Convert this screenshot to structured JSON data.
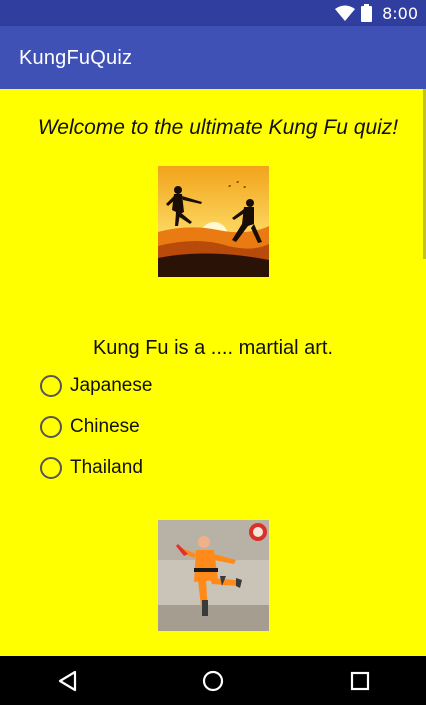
{
  "status_bar": {
    "time": "8:00",
    "icons": [
      "wifi-icon",
      "battery-icon"
    ]
  },
  "app_bar": {
    "title": "KungFuQuiz"
  },
  "main": {
    "welcome_text": "Welcome to the ultimate Kung Fu quiz!",
    "question": "Kung Fu is a .... martial art.",
    "options": [
      {
        "label": "Japanese",
        "selected": false
      },
      {
        "label": "Chinese",
        "selected": false
      },
      {
        "label": "Thailand",
        "selected": false
      }
    ],
    "images": [
      "sunset-fighters-image",
      "monk-kick-image"
    ]
  },
  "nav_bar": {
    "buttons": [
      "back-icon",
      "home-icon",
      "recents-icon"
    ]
  },
  "colors": {
    "status_bar": "#303F9F",
    "app_bar": "#3F51B5",
    "content_bg": "#FFFF00"
  }
}
